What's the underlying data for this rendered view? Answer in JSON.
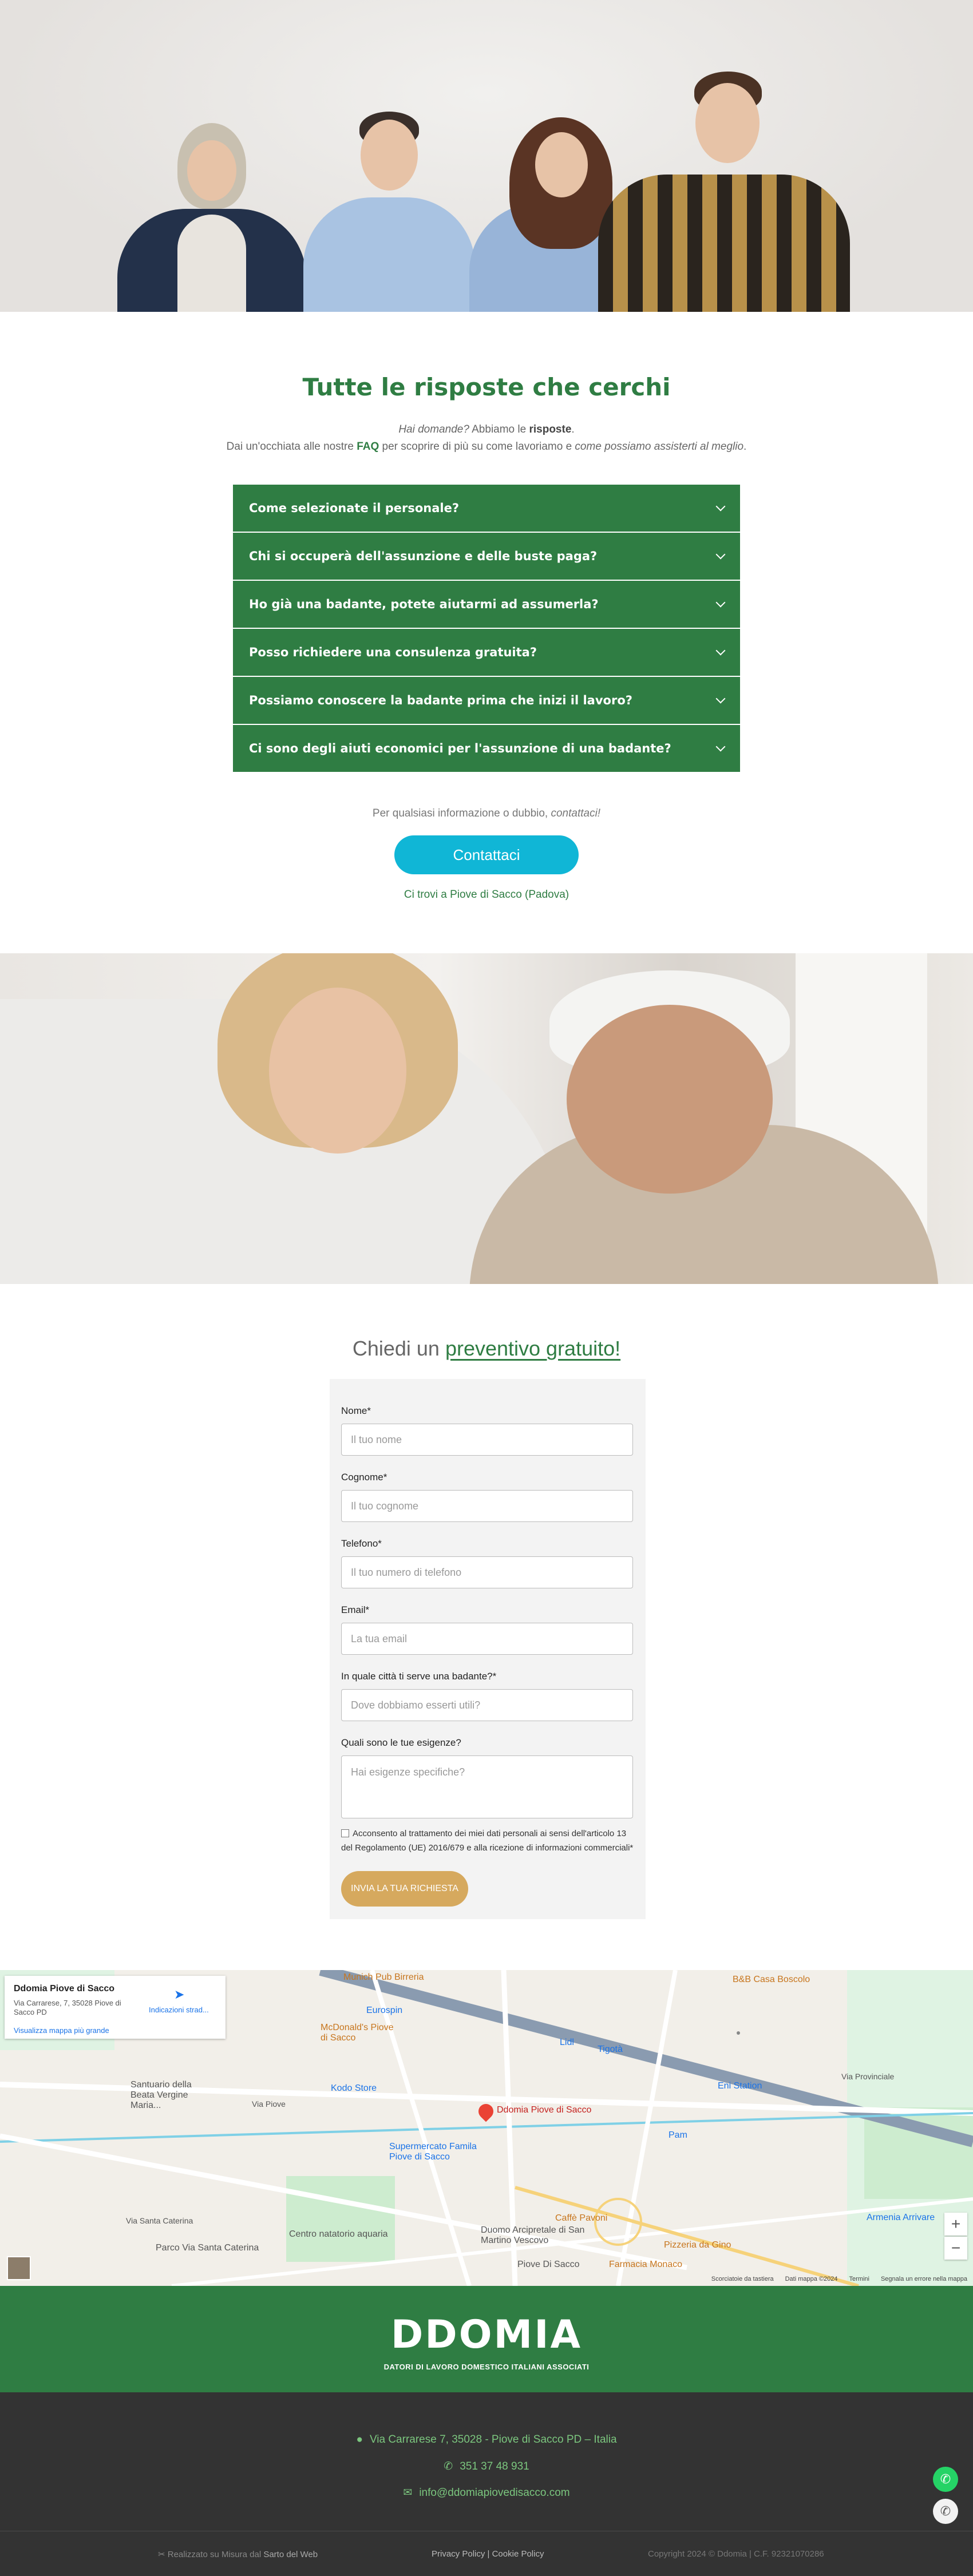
{
  "faq": {
    "title": "Tutte le risposte che cerchi",
    "line1_italic": "Hai domande?",
    "line1_text": " Abbiamo le ",
    "line1_bold": "risposte",
    "line1_end": ".",
    "line2_start": "Dai un'occhiata alle nostre ",
    "line2_link": "FAQ",
    "line2_mid": " per scoprire di più su come lavoriamo e ",
    "line2_italic": "come possiamo assisterti al meglio",
    "line2_end": ".",
    "items": [
      "Come selezionate il personale?",
      "Chi si occuperà dell'assunzione e delle buste paga?",
      "Ho già una badante, potete aiutarmi ad assumerla?",
      "Posso richiedere una consulenza gratuita?",
      "Possiamo conoscere la badante prima che inizi il lavoro?",
      "Ci sono degli aiuti economici per l'assunzione di una badante?"
    ],
    "info_text": "Per qualsiasi informazione o dubbio, ",
    "info_italic": "contattaci!",
    "contact_button": "Contattaci",
    "location_link": "Ci trovi a Piove di Sacco (Padova)"
  },
  "quote": {
    "title_start": "Chiedi un ",
    "title_highlight": "preventivo gratuito!",
    "fields": {
      "nome_label": "Nome*",
      "nome_placeholder": "Il tuo nome",
      "cognome_label": "Cognome*",
      "cognome_placeholder": "Il tuo cognome",
      "telefono_label": "Telefono*",
      "telefono_placeholder": "Il tuo numero di telefono",
      "email_label": "Email*",
      "email_placeholder": "La tua email",
      "citta_label": "In quale città ti serve una badante?*",
      "citta_placeholder": "Dove dobbiamo esserti utili?",
      "esigenze_label": "Quali sono le tue esigenze?",
      "esigenze_placeholder": "Hai esigenze specifiche?"
    },
    "consent": "Acconsento al trattamento dei miei dati personali ai sensi dell'articolo 13 del Regolamento (UE) 2016/679 e alla ricezione di informazioni commerciali*",
    "submit": "INVIA LA TUA RICHIESTA"
  },
  "map": {
    "place_name": "Ddomia Piove di Sacco",
    "address": "Via Carrarese, 7, 35028 Piove di Sacco PD",
    "larger_map": "Visualizza mappa più grande",
    "directions": "Indicazioni strad...",
    "pin_label": "Ddomia Piove di Sacco",
    "labels": {
      "munich": "Munich Pub Birreria",
      "eurospin": "Eurospin",
      "mcdonalds": "McDonald's Piove di Sacco",
      "kodo": "Kodo Store",
      "santuario": "Santuario della Beata Vergine Maria...",
      "supermercato": "Supermercato Famila Piove di Sacco",
      "centro": "Centro natatorio aquaria",
      "parco": "Parco Via Santa Caterina",
      "duomo": "Duomo Arcipretale di San Martino Vescovo",
      "caffe": "Caffè Pavoni",
      "lidl": "Lidl",
      "tigota": "Tigotà",
      "eni": "Eni Station",
      "pam": "Pam",
      "bb": "B&B Casa Boscolo",
      "pizzeria": "Pizzeria da Gino",
      "farmacia": "Farmacia Monaco",
      "armenia": "Armenia Arrivare",
      "piove": "Piove Di Sacco",
      "via_piove": "Via Piove",
      "via_santa_caterina": "Via Santa Caterina",
      "via_provinciale": "Via Provinciale"
    },
    "attrib_shortcuts": "Scorciatoie da tastiera",
    "attrib_data": "Dati mappa ©2024",
    "attrib_terms": "Termini",
    "attrib_report": "Segnala un errore nella mappa"
  },
  "brand": {
    "logo": "DDOMIA",
    "tagline": "DATORI DI LAVORO DOMESTICO ITALIANI ASSOCIATI"
  },
  "footer": {
    "address": "Via Carrarese 7, 35028 - Piove di Sacco PD – Italia",
    "phone": "351 37 48 931",
    "email": "info@ddomiapiovedisacco.com",
    "credit_start": "Realizzato su Misura dal ",
    "credit_link": "Sarto del Web",
    "privacy": "Privacy Policy",
    "cookie": "Cookie Policy",
    "copyright": "Copyright 2024 © Ddomia | C.F. 92321070286"
  },
  "colors": {
    "green": "#2f7d43",
    "cyan": "#10b6d6",
    "gold": "#d6a95e",
    "dark": "#333333"
  }
}
